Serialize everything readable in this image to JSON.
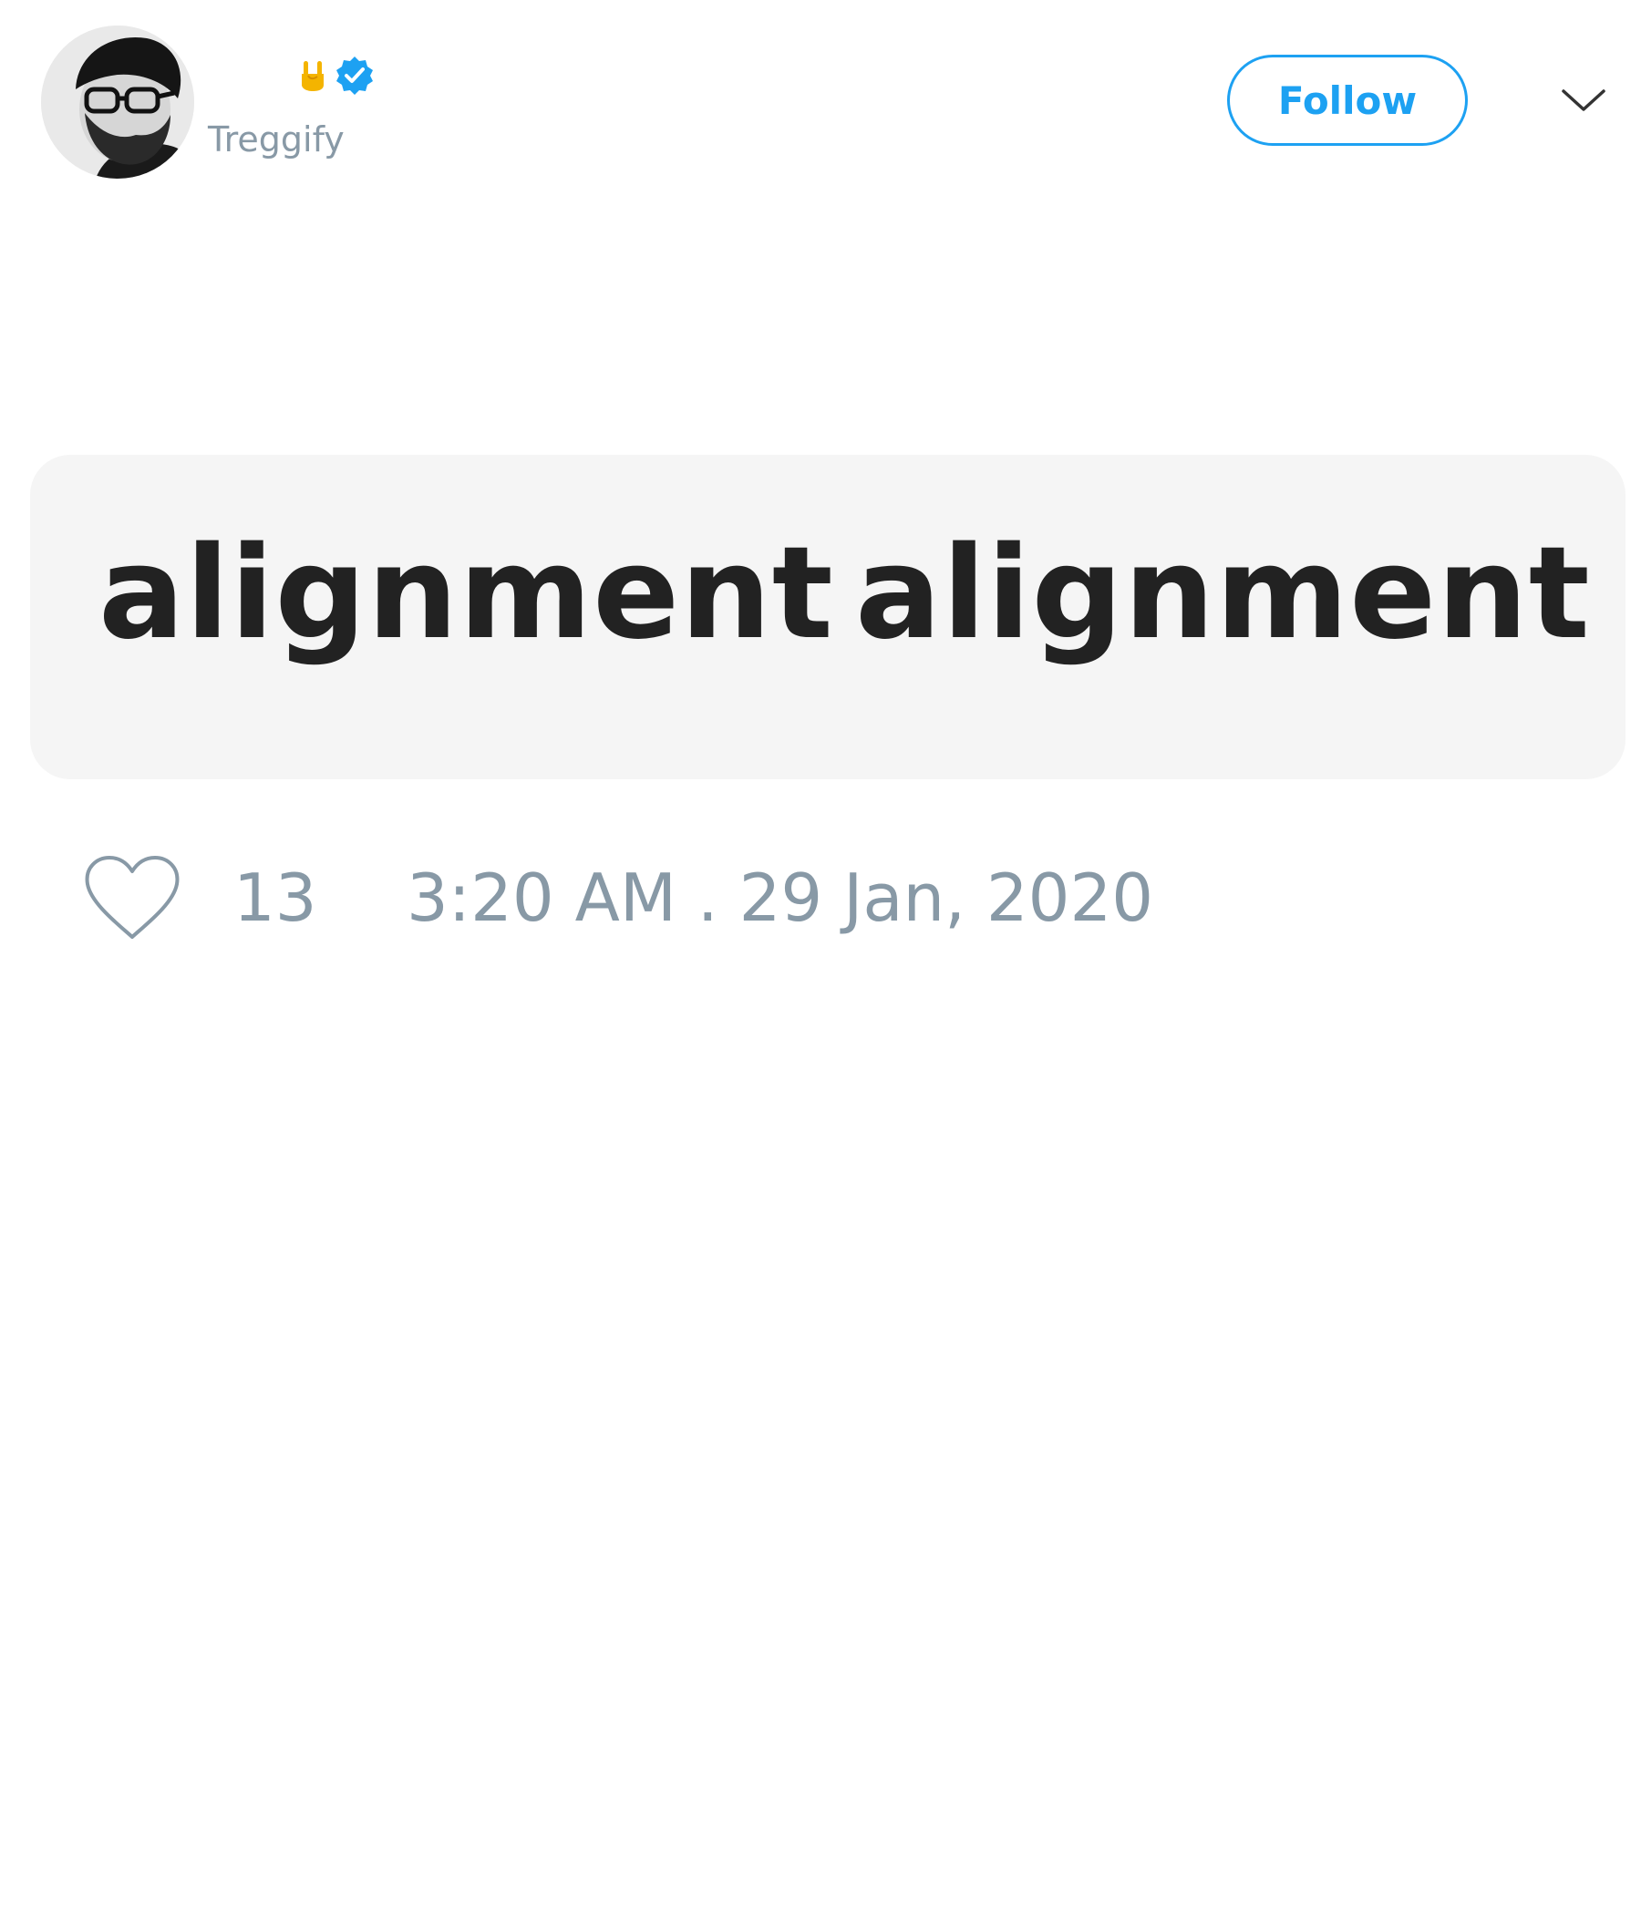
{
  "tweet": {
    "user": {
      "display_name": "",
      "handle": "Treggify",
      "verified": true,
      "name_emoji": "🤘",
      "avatar_icon": "avatar-photo"
    },
    "follow_label": "Follow",
    "menu_icon": "chevron-down-icon",
    "media": {
      "left_word": "alignment",
      "right_word": "alignment"
    },
    "likes": "13",
    "timestamp": "3:20 AM . 29 Jan, 2020"
  },
  "colors": {
    "accent": "#1da1f2",
    "muted_text": "#8899a6",
    "media_background": "#f5f5f5",
    "media_text": "#222222"
  }
}
